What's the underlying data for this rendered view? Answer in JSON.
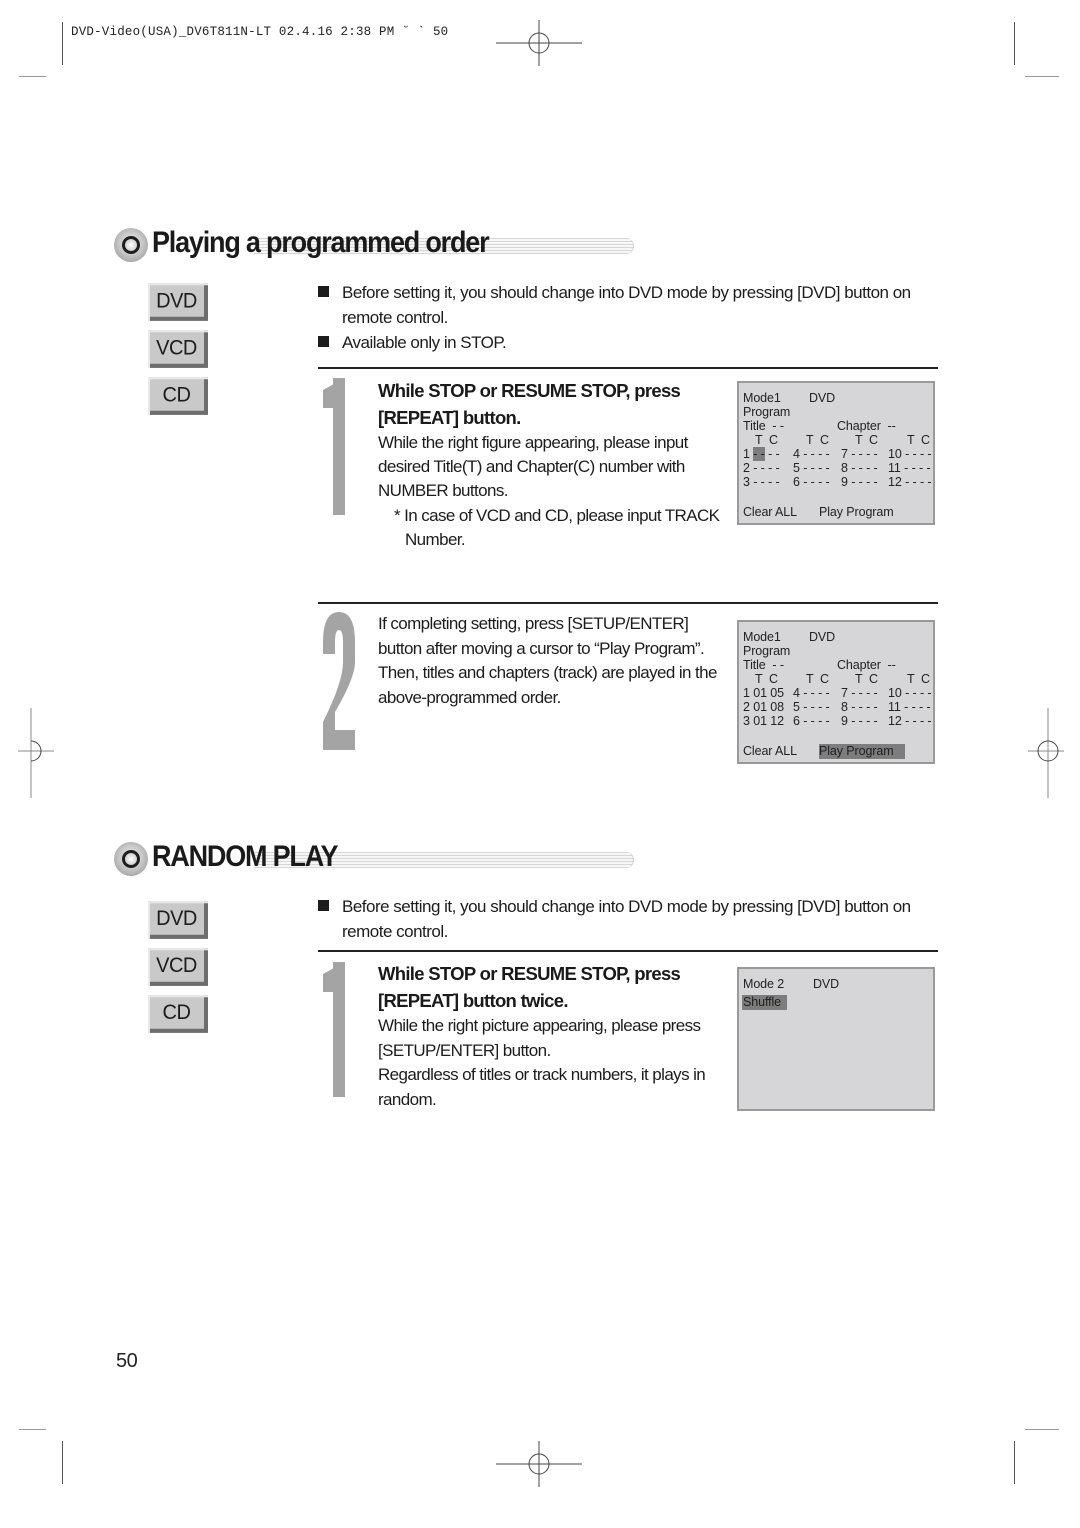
{
  "print_slug": "DVD-Video(USA)_DV6T811N-LT 02.4.16 2:38 PM ˘ ` 50",
  "colors": {
    "step_number": "#a4a4a4",
    "osd_bg": "#d6d6d8",
    "osd_highlight": "#7d7d7d",
    "mode_button": "#c9c9c9"
  },
  "icons": {
    "section_bullet": "circle-bullet-icon",
    "list_bullet": "square-bullet-icon",
    "registration_mark": "crosshair-registration-icon"
  },
  "sections": [
    {
      "title": "Playing a programmed order",
      "modes": [
        "DVD",
        "VCD",
        "CD"
      ],
      "notes": [
        {
          "line1": "Before setting it, you should change into DVD mode by pressing [DVD] button on",
          "line2": "remote control."
        },
        {
          "line1": "Available only in STOP.",
          "line2": ""
        }
      ],
      "steps": [
        {
          "number": "1",
          "title_lines": [
            "While STOP or RESUME STOP, press",
            "[REPEAT] button."
          ],
          "body_lines": [
            "While the right figure appearing, please input",
            "desired Title(T) and Chapter(C) number with",
            "NUMBER buttons."
          ],
          "note_lines": [
            "* In case of VCD and CD, please input TRACK",
            "Number."
          ],
          "osd": {
            "mode": "Mode1",
            "disc": "DVD",
            "program_label": "Program",
            "title_label": "Title  - -",
            "chapter_label": "Chapter  --",
            "col_header": "T  C",
            "slots": [
              {
                "n": "1",
                "value": "- -",
                "rest": " - -",
                "cursor": true
              },
              {
                "n": "2",
                "value": "- - - -"
              },
              {
                "n": "3",
                "value": "- - - -"
              },
              {
                "n": "4",
                "value": "- - - -"
              },
              {
                "n": "5",
                "value": "- - - -"
              },
              {
                "n": "6",
                "value": "- - - -"
              },
              {
                "n": "7",
                "value": "- - - -"
              },
              {
                "n": "8",
                "value": "- - - -"
              },
              {
                "n": "9",
                "value": "- - - -"
              },
              {
                "n": "10",
                "value": "- - - -"
              },
              {
                "n": "11",
                "value": "- - - -"
              },
              {
                "n": "12",
                "value": "- - - -"
              }
            ],
            "clear_all": "Clear ALL",
            "play_program": "Play Program",
            "play_program_selected": false
          }
        },
        {
          "number": "2",
          "title_lines": [],
          "body_lines": [
            "If completing setting, press [SETUP/ENTER]",
            "button after moving a cursor to “Play Program”.",
            "Then, titles and chapters (track) are played in the",
            "above-programmed order."
          ],
          "note_lines": [],
          "osd": {
            "mode": "Mode1",
            "disc": "DVD",
            "program_label": "Program",
            "title_label": "Title  - -",
            "chapter_label": "Chapter  --",
            "col_header": "T  C",
            "slots": [
              {
                "n": "1",
                "value": "01 05"
              },
              {
                "n": "2",
                "value": "01 08"
              },
              {
                "n": "3",
                "value": "01 12"
              },
              {
                "n": "4",
                "value": "- - - -"
              },
              {
                "n": "5",
                "value": "- - - -"
              },
              {
                "n": "6",
                "value": "- - - -"
              },
              {
                "n": "7",
                "value": "- - - -"
              },
              {
                "n": "8",
                "value": "- - - -"
              },
              {
                "n": "9",
                "value": "- - - -"
              },
              {
                "n": "10",
                "value": "- - - -"
              },
              {
                "n": "11",
                "value": "- - - -"
              },
              {
                "n": "12",
                "value": "- - - -"
              }
            ],
            "clear_all": "Clear ALL",
            "play_program": "Play Program",
            "play_program_selected": true
          }
        }
      ]
    },
    {
      "title": "RANDOM PLAY",
      "modes": [
        "DVD",
        "VCD",
        "CD"
      ],
      "notes": [
        {
          "line1": "Before setting it, you should change into DVD mode by pressing [DVD] button on",
          "line2": "remote control."
        }
      ],
      "steps": [
        {
          "number": "1",
          "title_lines": [
            "While STOP or RESUME STOP, press",
            "[REPEAT] button twice."
          ],
          "body_lines": [
            "While the right picture appearing, please press",
            "[SETUP/ENTER] button.",
            "Regardless of titles or track numbers, it plays in",
            "random."
          ],
          "note_lines": [],
          "osd": {
            "mode": "Mode 2",
            "disc": "DVD",
            "option": "Shuffle",
            "option_selected": true
          }
        }
      ]
    }
  ],
  "page_number": "50"
}
